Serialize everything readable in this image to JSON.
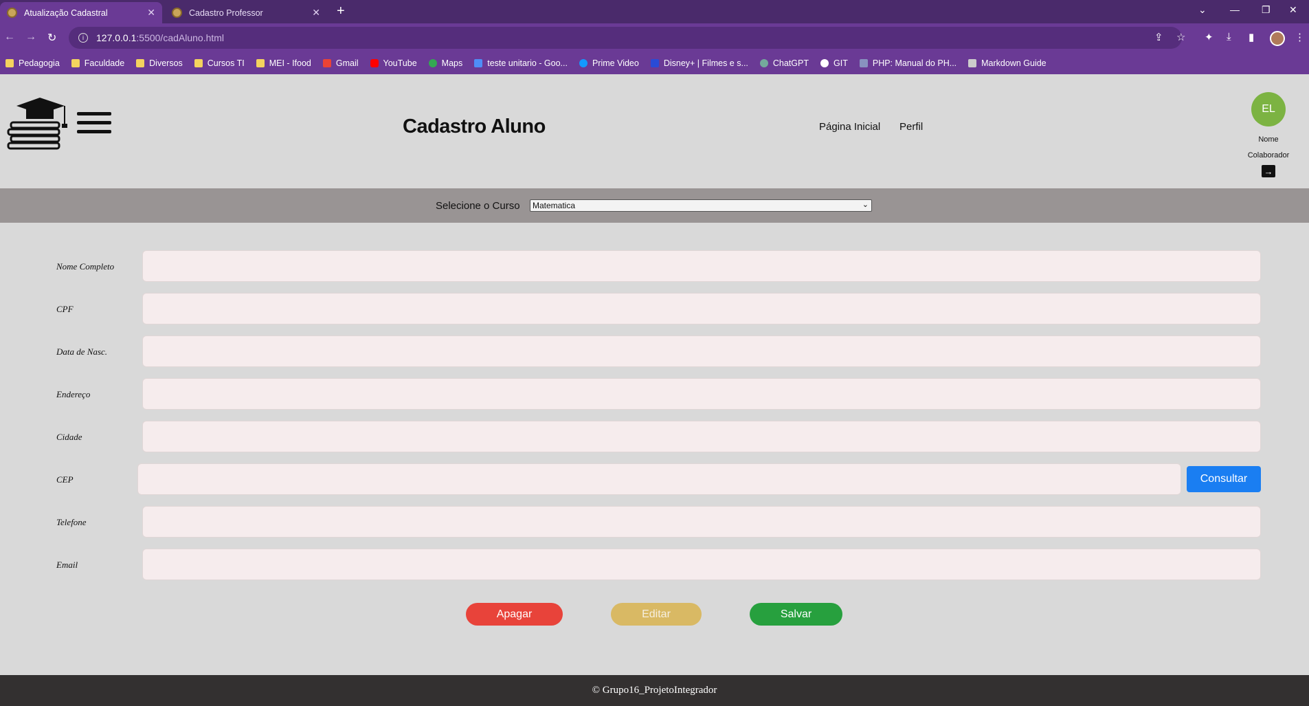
{
  "browser": {
    "tabs": [
      {
        "title": "Atualização Cadastral",
        "active": true
      },
      {
        "title": "Cadastro Professor",
        "active": false
      }
    ],
    "url_host": "127.0.0.1",
    "url_path": ":5500/cadAluno.html",
    "bookmarks": [
      {
        "label": "Pedagogia",
        "icon": "folder-icon"
      },
      {
        "label": "Faculdade",
        "icon": "folder-icon"
      },
      {
        "label": "Diversos",
        "icon": "folder-icon"
      },
      {
        "label": "Cursos TI",
        "icon": "folder-icon"
      },
      {
        "label": "MEI - Ifood",
        "icon": "folder-icon"
      },
      {
        "label": "Gmail",
        "icon": "gmail-icon"
      },
      {
        "label": "YouTube",
        "icon": "youtube-icon"
      },
      {
        "label": "Maps",
        "icon": "maps-icon"
      },
      {
        "label": "teste unitario - Goo...",
        "icon": "site-icon"
      },
      {
        "label": "Prime Video",
        "icon": "prime-video-icon"
      },
      {
        "label": "Disney+ | Filmes e s...",
        "icon": "disney-icon"
      },
      {
        "label": "ChatGPT",
        "icon": "chatgpt-icon"
      },
      {
        "label": "GIT",
        "icon": "github-icon"
      },
      {
        "label": "PHP: Manual do PH...",
        "icon": "php-icon"
      },
      {
        "label": "Markdown Guide",
        "icon": "markdown-icon"
      }
    ]
  },
  "header": {
    "title": "Cadastro Aluno",
    "nav": [
      "Página Inicial",
      "Perfil"
    ],
    "user_initials": "EL",
    "user_name_line1": "Nome",
    "user_name_line2": "Colaborador"
  },
  "course": {
    "label": "Selecione o Curso",
    "selected": "Matematica"
  },
  "form": {
    "fields": [
      {
        "label": "Nome Completo",
        "value": ""
      },
      {
        "label": "CPF",
        "value": ""
      },
      {
        "label": "Data de Nasc.",
        "value": ""
      },
      {
        "label": "Endereço",
        "value": ""
      },
      {
        "label": "Cidade",
        "value": ""
      },
      {
        "label": "CEP",
        "value": ""
      },
      {
        "label": "Telefone",
        "value": ""
      },
      {
        "label": "Email",
        "value": ""
      }
    ],
    "consultar_label": "Consultar",
    "apagar_label": "Apagar",
    "editar_label": "Editar",
    "salvar_label": "Salvar"
  },
  "footer": {
    "text": "© Grupo16_ProjetoIntegrador"
  },
  "colors": {
    "browser_frame": "#6a3a95",
    "avatar": "#7cb342",
    "consultar": "#1a7ef2",
    "apagar": "#e8433a",
    "editar": "#d9b964",
    "salvar": "#27a03e"
  }
}
